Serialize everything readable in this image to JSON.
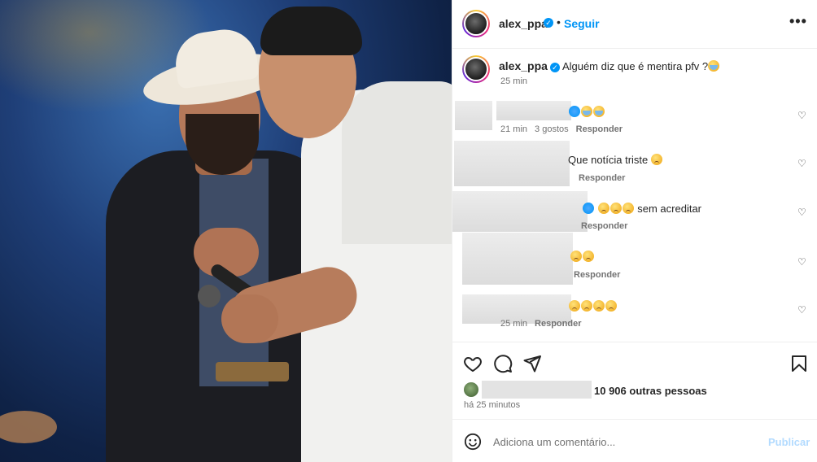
{
  "header": {
    "username": "alex_ppa",
    "separator": "•",
    "follow_label": "Seguir",
    "more_label": "•••"
  },
  "caption": {
    "username": "alex_ppa",
    "text": "Alguém diz que é mentira pfv ?",
    "time": "25 min"
  },
  "comments": [
    {
      "text": "",
      "meta_time": "21 min",
      "meta_likes": "3 gostos",
      "reply": "Responder"
    },
    {
      "text": "Que notícia triste",
      "meta_time": "",
      "meta_likes": "",
      "reply": "Responder"
    },
    {
      "text": "sem acreditar",
      "meta_time": "",
      "meta_likes": "",
      "reply": "Responder"
    },
    {
      "text": "",
      "meta_time": "",
      "meta_likes": "",
      "reply": "Responder"
    },
    {
      "text": "",
      "meta_time": "25 min",
      "meta_likes": "",
      "reply": "Responder"
    }
  ],
  "likes": {
    "others_text": "10 906 outras pessoas",
    "time": "há 25 minutos"
  },
  "add_comment": {
    "placeholder": "Adiciona um comentário...",
    "publish_label": "Publicar"
  },
  "colors": {
    "accent": "#0095f6",
    "muted": "#737373",
    "publish_disabled": "#b3dbff"
  },
  "icons": [
    "heart-icon",
    "comment-icon",
    "share-icon",
    "bookmark-icon",
    "emoji-icon",
    "more-icon",
    "verified-icon"
  ]
}
